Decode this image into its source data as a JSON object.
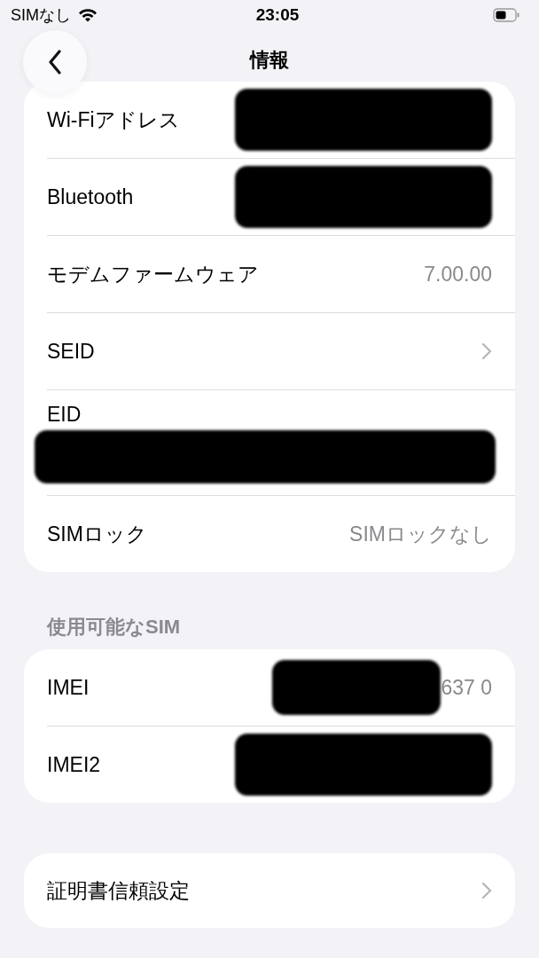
{
  "status_bar": {
    "carrier": "SIMなし",
    "time": "23:05"
  },
  "nav": {
    "title": "情報"
  },
  "groups": [
    {
      "rows": [
        {
          "kind": "value",
          "label": "Wi-Fiアドレス",
          "redacted": true
        },
        {
          "kind": "value",
          "label": "Bluetooth",
          "redacted": true
        },
        {
          "kind": "value",
          "label": "モデムファームウェア",
          "value": "7.00.00"
        },
        {
          "kind": "chevron",
          "label": "SEID"
        },
        {
          "kind": "stacked",
          "label": "EID",
          "redacted": true
        },
        {
          "kind": "value",
          "label": "SIMロック",
          "value": "SIMロックなし"
        }
      ]
    },
    {
      "header": "使用可能なSIM",
      "rows": [
        {
          "kind": "value",
          "label": "IMEI",
          "value": "637 0",
          "redacted": true
        },
        {
          "kind": "value",
          "label": "IMEI2",
          "redacted": true
        }
      ]
    },
    {
      "rows": [
        {
          "kind": "chevron",
          "label": "証明書信頼設定"
        }
      ]
    }
  ]
}
